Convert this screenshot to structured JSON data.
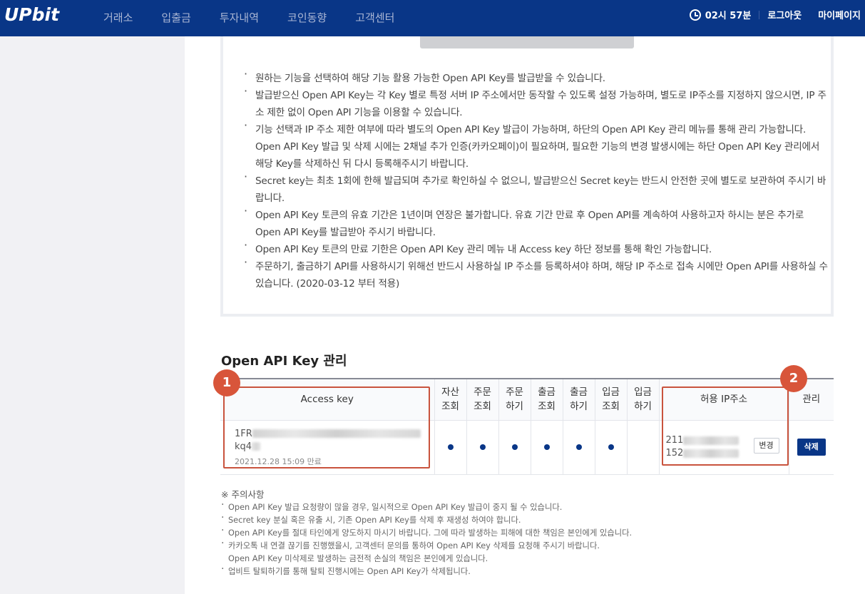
{
  "header": {
    "logo": "UPbit",
    "nav": [
      "거래소",
      "입출금",
      "투자내역",
      "코인동향",
      "고객센터"
    ],
    "time": "02시 57분",
    "logout": "로그아웃",
    "mypage": "마이페이지"
  },
  "notices": [
    "원하는 기능을 선택하여 해당 기능 활용 가능한 Open API Key를 발급받을 수 있습니다.",
    "발급받으신 Open API Key는 각 Key 별로 특정 서버 IP 주소에서만 동작할 수 있도록 설정 가능하며, 별도로 IP주소를 지정하지 않으시면, IP 주소 제한 없이 Open API 기능을 이용할 수 있습니다.",
    "기능 선택과 IP 주소 제한 여부에 따라 별도의 Open API Key 발급이 가능하며, 하단의 Open API Key 관리 메뉴를 통해 관리 가능합니다. Open API Key 발급 및 삭제 시에는 2채널 추가 인증(카카오페이)이 필요하며, 필요한 기능의 변경 발생시에는 하단 Open API Key 관리에서 해당 Key를 삭제하신 뒤 다시 등록해주시기 바랍니다.",
    "Secret key는 최초 1회에 한해 발급되며 추가로 확인하실 수 없으니, 발급받으신 Secret key는 반드시 안전한 곳에 별도로 보관하여 주시기 바랍니다.",
    "Open API Key 토큰의 유효 기간은 1년이며 연장은 불가합니다. 유효 기간 만료 후 Open API를 계속하여 사용하고자 하시는 분은 추가로 Open API Key를 발급받아 주시기 바랍니다.",
    "Open API Key 토큰의 만료 기한은 Open API Key 관리 메뉴 내 Access key 하단 정보를 통해 확인 가능합니다.",
    "주문하기, 출금하기 API를 사용하시기 위해선 반드시 사용하실 IP 주소를 등록하셔야 하며, 해당 IP 주소로 접속 시에만 Open API를 사용하실 수 있습니다. (2020-03-12 부터 적용)"
  ],
  "section_title": "Open API Key 관리",
  "table": {
    "headers": {
      "access_key": "Access key",
      "asset_view": [
        "자산",
        "조회"
      ],
      "order_view": [
        "주문",
        "조회"
      ],
      "order_do": [
        "주문",
        "하기"
      ],
      "withdraw_view": [
        "출금",
        "조회"
      ],
      "withdraw_do": [
        "출금",
        "하기"
      ],
      "deposit_view": [
        "입금",
        "조회"
      ],
      "deposit_do": [
        "입금",
        "하기"
      ],
      "ip": "허용 IP주소",
      "manage": "관리"
    },
    "row": {
      "key_line1": "1FR",
      "key_line2": "kq4",
      "expiry": "2021.12.28 15:09 만료",
      "ip_line1": "211",
      "ip_line2": "152",
      "change_btn": "변경",
      "delete_btn": "삭제",
      "permissions": [
        true,
        true,
        true,
        true,
        true,
        true,
        false
      ]
    }
  },
  "badges": [
    "1",
    "2"
  ],
  "caution": {
    "title": "※ 주의사항",
    "items": [
      "Open API Key 발급 요청량이 많을 경우, 일시적으로 Open API Key 발급이 중지 될 수 있습니다.",
      "Secret key 분실 혹은 유출 시, 기존 Open API Key를 삭제 후 재생성 하여야 합니다.",
      "Open API Key를 절대 타인에게 양도하지 마시기 바랍니다. 그에 따라 발생하는 피해에 대한 책임은 본인에게 있습니다.",
      "카카오톡 내 연결 끊기를 진행했을시, 고객센터 문의를 통하여 Open API Key 삭제를 요청해 주시기 바랍니다.",
      "업비트 탈퇴하기를 통해 탈퇴 진행시에는 Open API Key가 삭제됩니다."
    ],
    "item4_cont": "Open API Key 미삭제로 발생하는 금전적 손실의 책임은 본인에게 있습니다."
  },
  "colors": {
    "header": "#093687",
    "accent": "#093687",
    "highlight": "#c9533d"
  }
}
